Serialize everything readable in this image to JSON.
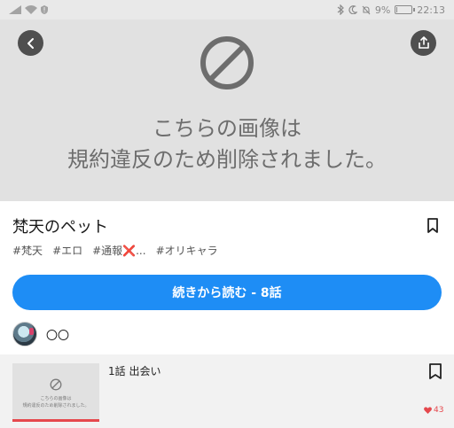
{
  "status_bar": {
    "battery_text": "9%",
    "time": "22:13",
    "battery_level": 0.09
  },
  "hero": {
    "blocked_line1": "こちらの画像は",
    "blocked_line2": "規約違反のため削除されました。"
  },
  "work": {
    "title": "梵天のペット",
    "tags": [
      "#梵天",
      "#エロ",
      "#通報❌...",
      "#オリキャラ"
    ],
    "read_button": "続きから読む - 8話",
    "author": "〇〇"
  },
  "episode": {
    "title": "1話 出会い",
    "thumb_line1": "こちらの画像は",
    "thumb_line2": "規約違反のため削除されました。",
    "likes": "43",
    "read_progress": 1.0
  },
  "colors": {
    "accent": "#1e8df5",
    "like": "#e5484d",
    "hero_bg": "#e1e1e1"
  }
}
